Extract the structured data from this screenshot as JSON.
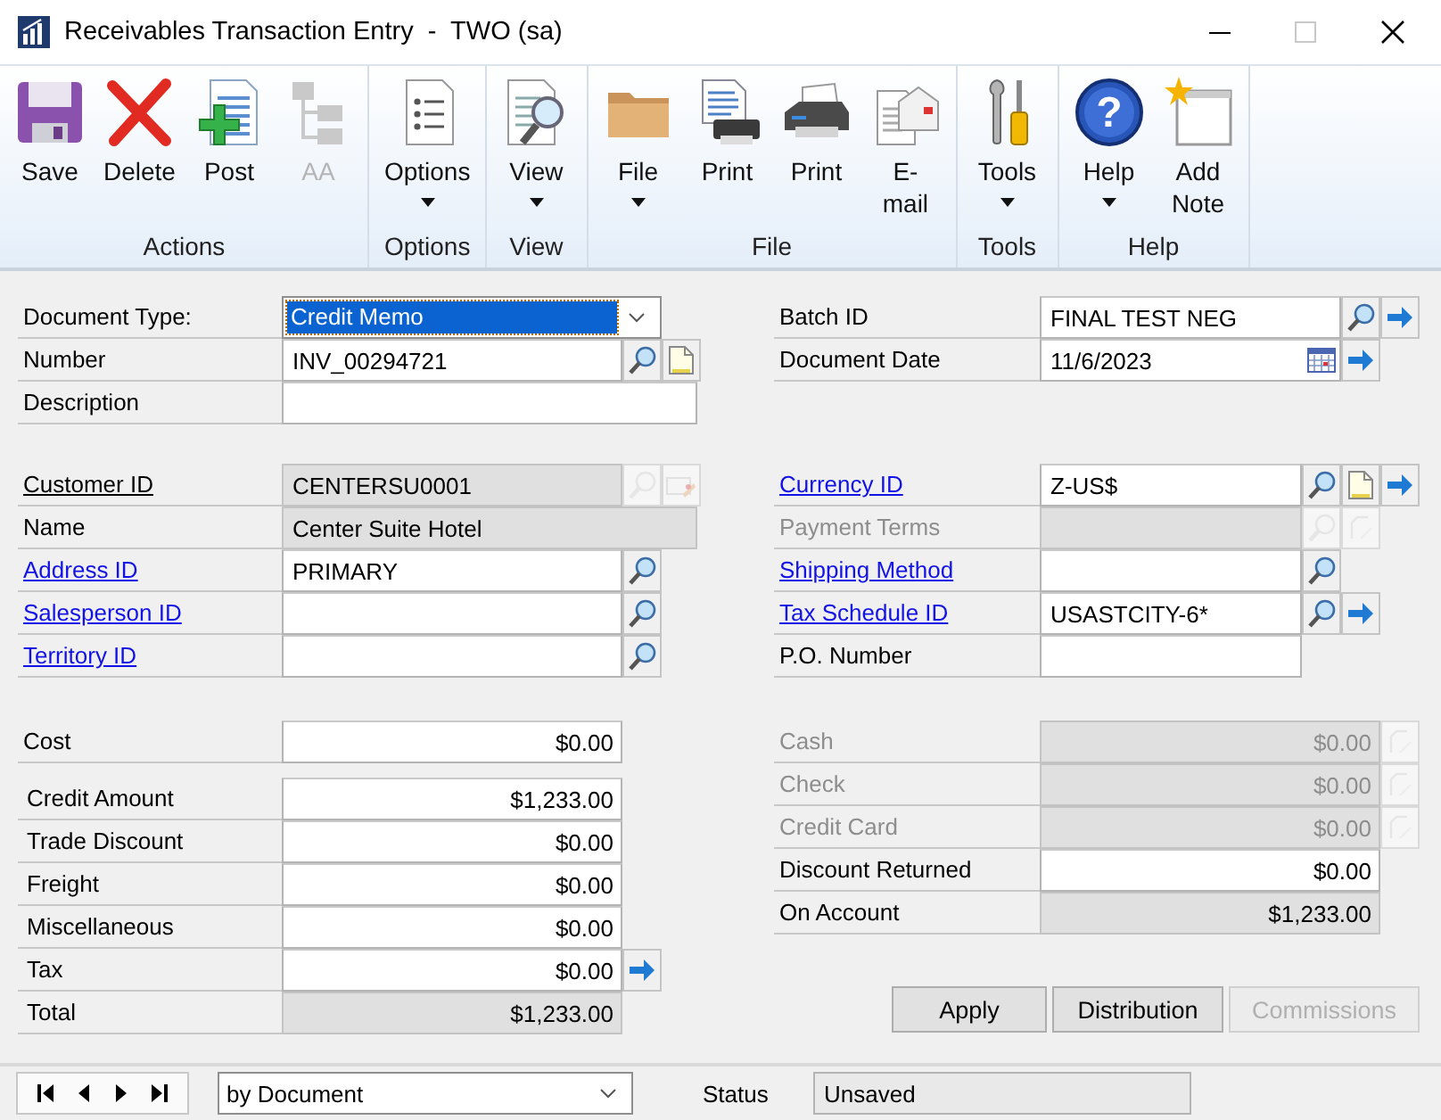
{
  "window": {
    "title": "Receivables Transaction Entry  -  TWO (sa)"
  },
  "ribbon": [
    {
      "label": "Actions",
      "buttons": [
        {
          "label": "Save",
          "kind": "save",
          "disabled": false,
          "dropdown": false
        },
        {
          "label": "Delete",
          "kind": "delete",
          "disabled": false,
          "dropdown": false
        },
        {
          "label": "Post",
          "kind": "post",
          "disabled": false,
          "dropdown": false
        },
        {
          "label": "AA",
          "kind": "tree",
          "disabled": true,
          "dropdown": false
        }
      ]
    },
    {
      "label": "Options",
      "buttons": [
        {
          "label": "Options",
          "kind": "list",
          "disabled": false,
          "dropdown": true
        }
      ]
    },
    {
      "label": "View",
      "buttons": [
        {
          "label": "View",
          "kind": "preview",
          "disabled": false,
          "dropdown": true
        }
      ]
    },
    {
      "label": "File",
      "buttons": [
        {
          "label": "File",
          "kind": "folder",
          "disabled": false,
          "dropdown": true
        },
        {
          "label": "Print",
          "kind": "print-doc",
          "disabled": false,
          "dropdown": false
        },
        {
          "label": "Print",
          "kind": "printer",
          "disabled": false,
          "dropdown": false
        },
        {
          "label": "E-mail",
          "kind": "email",
          "disabled": false,
          "dropdown": false
        }
      ]
    },
    {
      "label": "Tools",
      "buttons": [
        {
          "label": "Tools",
          "kind": "tools",
          "disabled": false,
          "dropdown": true
        }
      ]
    },
    {
      "label": "Help",
      "buttons": [
        {
          "label": "Help",
          "kind": "help",
          "glyph": "?",
          "disabled": false,
          "dropdown": true
        },
        {
          "label": "Add Note",
          "kind": "note",
          "disabled": false,
          "dropdown": false
        }
      ]
    }
  ],
  "document_fields": [
    {
      "label": "Document Type:",
      "link": false,
      "underlined": false,
      "disabled": false,
      "kind": "dropdown",
      "value": "Credit Memo",
      "highlighted": true
    },
    {
      "label": "Number",
      "link": false,
      "underlined": false,
      "disabled": false,
      "kind": "text",
      "value": "INV_00294721",
      "readonly": false,
      "buttons": [
        {
          "kind": "lookup",
          "disabled": false
        },
        {
          "kind": "note",
          "disabled": false
        }
      ]
    },
    {
      "label": "Description",
      "link": false,
      "underlined": false,
      "disabled": false,
      "kind": "text",
      "readonly": false
    }
  ],
  "customer_fields": [
    {
      "label": "Customer ID",
      "link": false,
      "underlined": true,
      "disabled": false,
      "value": "CENTERSU0001",
      "readonly": true,
      "buttons": [
        {
          "kind": "lookup",
          "disabled": true
        },
        {
          "kind": "card",
          "disabled": true
        }
      ]
    },
    {
      "label": "Name",
      "link": false,
      "underlined": false,
      "disabled": false,
      "value": "Center Suite Hotel",
      "readonly": true
    },
    {
      "label": "Address ID",
      "link": true,
      "underlined": true,
      "disabled": false,
      "value": "PRIMARY",
      "readonly": false,
      "buttons": [
        {
          "kind": "lookup",
          "disabled": false
        }
      ]
    },
    {
      "label": "Salesperson ID",
      "link": true,
      "underlined": true,
      "disabled": false,
      "readonly": false,
      "buttons": [
        {
          "kind": "lookup",
          "disabled": false
        }
      ]
    },
    {
      "label": "Territory ID",
      "link": true,
      "underlined": true,
      "disabled": false,
      "readonly": false,
      "buttons": [
        {
          "kind": "lookup",
          "disabled": false
        }
      ]
    }
  ],
  "batch_fields": [
    {
      "label": "Batch ID",
      "link": false,
      "underlined": false,
      "disabled": false,
      "kind": "text",
      "value": "FINAL TEST NEG",
      "readonly": false,
      "buttons": [
        {
          "kind": "lookup",
          "disabled": false
        },
        {
          "kind": "arrow",
          "disabled": false
        }
      ]
    },
    {
      "label": "Document Date",
      "link": false,
      "underlined": false,
      "disabled": false,
      "kind": "date",
      "value": "11/6/2023",
      "readonly": false,
      "buttons": [
        {
          "kind": "arrow",
          "disabled": false
        }
      ]
    }
  ],
  "currency_fields": [
    {
      "label": "Currency ID",
      "link": true,
      "underlined": true,
      "disabled": false,
      "value": "Z-US$",
      "readonly": false,
      "buttons": [
        {
          "kind": "lookup",
          "disabled": false
        },
        {
          "kind": "note",
          "disabled": false
        },
        {
          "kind": "arrow",
          "disabled": false
        }
      ]
    },
    {
      "label": "Payment Terms",
      "link": false,
      "underlined": false,
      "disabled": true,
      "readonly": true,
      "buttons": [
        {
          "kind": "lookup",
          "disabled": true
        },
        {
          "kind": "expand",
          "disabled": true
        }
      ]
    },
    {
      "label": "Shipping Method",
      "link": true,
      "underlined": true,
      "disabled": false,
      "readonly": false,
      "buttons": [
        {
          "kind": "lookup",
          "disabled": false
        }
      ]
    },
    {
      "label": "Tax Schedule ID",
      "link": true,
      "underlined": true,
      "disabled": false,
      "value": "USASTCITY-6*",
      "readonly": false,
      "buttons": [
        {
          "kind": "lookup",
          "disabled": false
        },
        {
          "kind": "arrow",
          "disabled": false
        }
      ]
    },
    {
      "label": "P.O. Number",
      "link": false,
      "underlined": false,
      "disabled": false,
      "readonly": false
    }
  ],
  "cost_fields": [
    {
      "label": "Cost",
      "value": "$0.00",
      "readonly": false
    }
  ],
  "amount_fields": [
    {
      "label": "Credit Amount",
      "value": "$1,233.00",
      "readonly": false
    },
    {
      "label": "Trade Discount",
      "value": "$0.00",
      "readonly": false
    },
    {
      "label": "Freight",
      "value": "$0.00",
      "readonly": false
    },
    {
      "label": "Miscellaneous",
      "value": "$0.00",
      "readonly": false
    },
    {
      "label": "Tax",
      "value": "$0.00",
      "readonly": false,
      "buttons": [
        {
          "kind": "arrow",
          "disabled": false
        }
      ]
    },
    {
      "label": "Total",
      "value": "$1,233.00",
      "readonly": true
    }
  ],
  "payment_fields": [
    {
      "label": "Cash",
      "disabled": true,
      "value": "$0.00",
      "readonly": true,
      "buttons": [
        {
          "kind": "expand",
          "disabled": true
        }
      ]
    },
    {
      "label": "Check",
      "disabled": true,
      "value": "$0.00",
      "readonly": true,
      "buttons": [
        {
          "kind": "expand",
          "disabled": true
        }
      ]
    },
    {
      "label": "Credit Card",
      "disabled": true,
      "value": "$0.00",
      "readonly": true,
      "buttons": [
        {
          "kind": "expand",
          "disabled": true
        }
      ]
    },
    {
      "label": "Discount Returned",
      "disabled": false,
      "value": "$0.00",
      "readonly": false
    },
    {
      "label": "On Account",
      "disabled": false,
      "value": "$1,233.00",
      "readonly": true
    }
  ],
  "actions": [
    {
      "label": "Apply",
      "disabled": false
    },
    {
      "label": "Distribution",
      "disabled": false
    },
    {
      "label": "Commissions",
      "disabled": true
    }
  ],
  "status_bar": {
    "browse": "by Document",
    "status_label": "Status",
    "status": "Unsaved"
  }
}
